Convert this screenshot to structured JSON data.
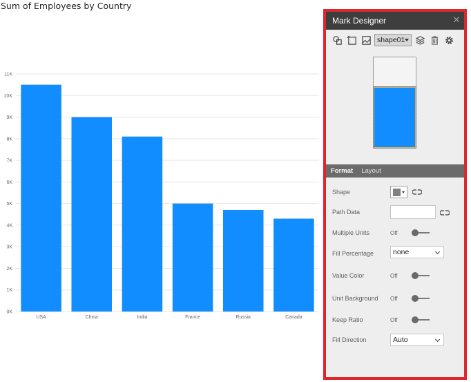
{
  "chart_title": "Sum of Employees by Country",
  "chart_data": {
    "type": "bar",
    "title": "Sum of Employees by Country",
    "categories": [
      "USA",
      "China",
      "India",
      "France",
      "Russia",
      "Canada"
    ],
    "values": [
      10500,
      9000,
      8100,
      5000,
      4700,
      4300
    ],
    "y_ticks": [
      0,
      1000,
      2000,
      3000,
      4000,
      5000,
      6000,
      7000,
      8000,
      9000,
      10000,
      11000
    ],
    "y_tick_labels": [
      "0K",
      "1K",
      "2K",
      "3K",
      "4K",
      "5K",
      "6K",
      "7K",
      "8K",
      "9K",
      "10K",
      "11K"
    ],
    "ylim": [
      0,
      11000
    ],
    "grid": true,
    "bar_color": "#118dff"
  },
  "panel": {
    "title": "Mark Designer",
    "close_glyph": "✕",
    "toolbar": {
      "icons": [
        "shapes-icon",
        "frame-icon",
        "image-icon"
      ],
      "shape_select": "shape01",
      "trailing_icons": [
        "layers-icon",
        "trash-icon",
        "gear-icon"
      ]
    },
    "preview": {
      "fill_fraction": 0.68,
      "fill_color": "#118dff"
    },
    "tabs": [
      {
        "label": "Format",
        "active": true
      },
      {
        "label": "Layout",
        "active": false
      }
    ],
    "properties": {
      "shape": {
        "label": "Shape"
      },
      "path_data": {
        "label": "Path Data",
        "value": ""
      },
      "multiple_units": {
        "label": "Multiple Units",
        "state": "Off"
      },
      "fill_percentage": {
        "label": "Fill Percentage",
        "value": "none"
      },
      "value_color": {
        "label": "Value Color",
        "state": "Off"
      },
      "unit_background": {
        "label": "Unit Background",
        "state": "Off"
      },
      "keep_ratio": {
        "label": "Keep Ratio",
        "state": "Off"
      },
      "fill_direction": {
        "label": "Fill Direction",
        "value": "Auto"
      }
    }
  },
  "colors": {
    "highlight_border": "#e0262b",
    "panel_header": "#3e3e3e",
    "tabs_bar": "#6b6b6b"
  }
}
